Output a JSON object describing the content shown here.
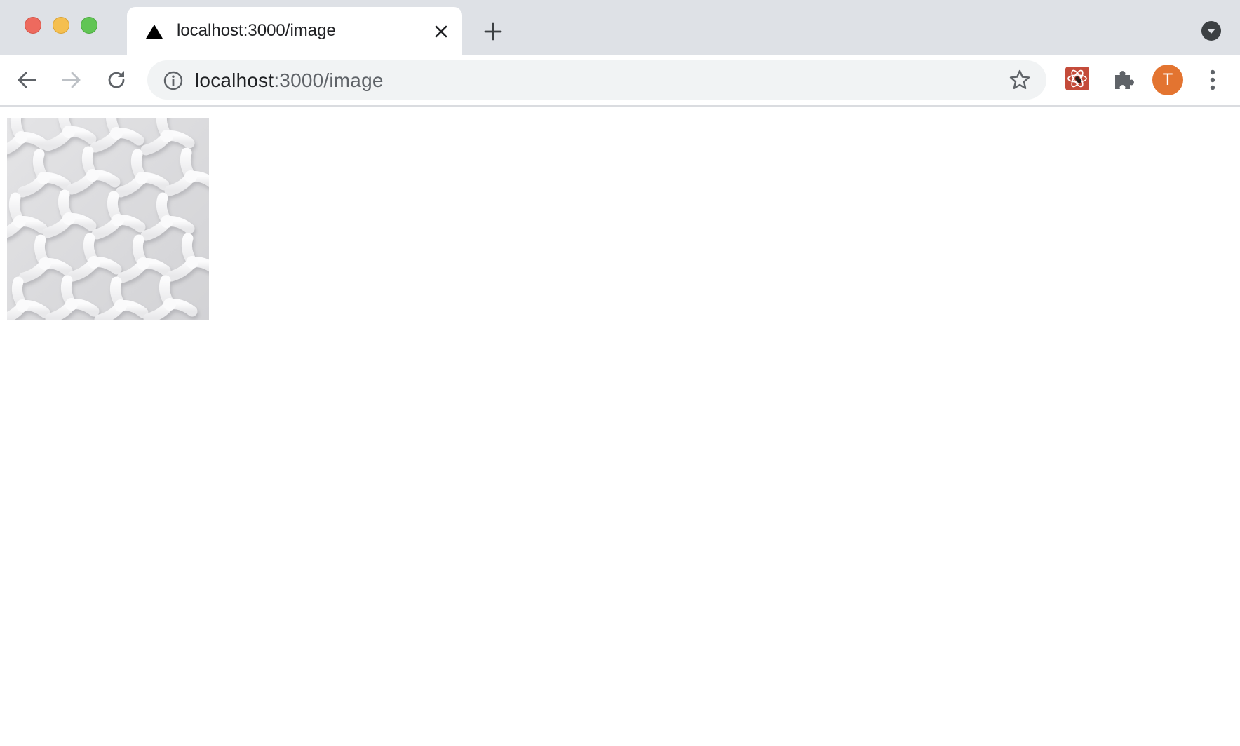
{
  "window": {
    "controls": {
      "close": "close",
      "minimize": "minimize",
      "maximize": "maximize"
    }
  },
  "tab": {
    "title": "localhost:3000/image",
    "favicon": "triangle-icon",
    "close_icon": "close-icon"
  },
  "toolbar": {
    "back_icon": "back-arrow-icon",
    "forward_icon": "forward-arrow-icon",
    "reload_icon": "reload-icon",
    "url_host": "localhost",
    "url_rest": ":3000/image",
    "bookmark_icon": "star-icon",
    "extensions": [
      "react-devtools-icon",
      "puzzle-icon"
    ],
    "profile_initial": "T",
    "menu_icon": "kebab-menu-icon"
  },
  "colors": {
    "tabstrip_bg": "#dee1e6",
    "omnibox_bg": "#f1f3f4",
    "avatar_bg": "#e37430",
    "react_ext_bg": "#c44b3a"
  },
  "content": {
    "image": {
      "description_icon": "white-woven-pattern-image"
    }
  }
}
